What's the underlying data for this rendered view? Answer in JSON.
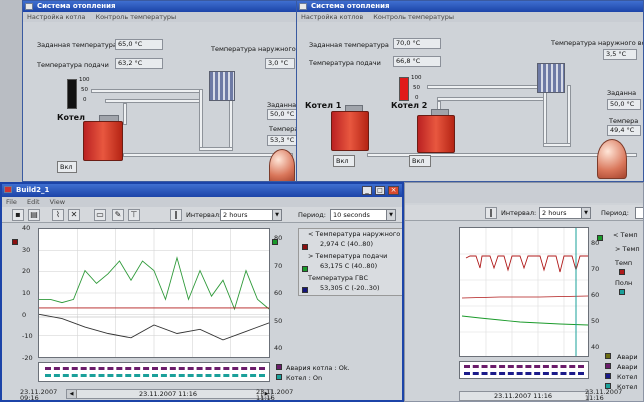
{
  "windows": {
    "heating_left": {
      "title": "Система отопления",
      "menu": [
        "Настройка котла",
        "Контроль температуры"
      ],
      "labels": {
        "set_temp": "Заданная температура",
        "supply_temp": "Температура подачи",
        "outdoor_temp": "Температура наружного воз",
        "boiler": "Котел",
        "right_set": "Заданна",
        "right_temp": "Темпера"
      },
      "values": {
        "set_temp": "65,0 °C",
        "supply_temp": "63,2 °C",
        "outdoor_temp": "3,0 °C",
        "right_set": "50,0 °C",
        "right_temp": "53,3 °C",
        "range_top": "100",
        "range_mid": "50",
        "range_bot": "0"
      },
      "on_button": "Вкл"
    },
    "heating_right": {
      "title": "Система отопления",
      "menu": [
        "Настройка котлов",
        "Контроль температуры"
      ],
      "labels": {
        "set_temp": "Заданная температура",
        "supply_temp": "Температура подачи",
        "outdoor_temp": "Температура наружного во",
        "boiler1": "Котел 1",
        "boiler2": "Котел 2",
        "right_set": "Заданна",
        "right_temp": "Темпера"
      },
      "values": {
        "set_temp": "70,0 °C",
        "supply_temp": "66,8 °C",
        "outdoor_temp": "3,5 °C",
        "right_set": "50,0 °C",
        "right_temp": "49,4 °C",
        "range_top": "100",
        "range_mid": "50",
        "range_bot": "0"
      },
      "on_button1": "Вкл",
      "on_button2": "Вкл"
    },
    "build": {
      "title": "Build2_1",
      "menu": [
        "File",
        "Edit",
        "View"
      ],
      "interval_label": "Интервал:",
      "interval_value": "2 hours",
      "period_label": "Период:",
      "period_value": "10 seconds",
      "legend": [
        {
          "name": "< Температура наружного в",
          "value": "2,974 C  (40..80)",
          "color": "#8b1010"
        },
        {
          "name": "> Температура подачи",
          "value": "63,175 C  (40..80)",
          "color": "#1a9a2a"
        },
        {
          "name": "Температура ГВС",
          "value": "53,305 C  (-20..30)",
          "color": "#14147a"
        }
      ],
      "alarms": [
        {
          "name": "Авария котла : Ok.",
          "color": "#6b1c6b"
        },
        {
          "name": "Котел : On",
          "color": "#1aa09a"
        }
      ],
      "y_left_ticks": [
        "40",
        "30",
        "20",
        "10",
        "0",
        "-10",
        "-20"
      ],
      "y_right_ticks": [
        "80",
        "70",
        "60",
        "50",
        "40"
      ],
      "x_start": "23.11.2007\n09:16",
      "x_center": "23.11.2007 11:16",
      "x_end": "23.11.2007\n11:16",
      "ctl_mid": "2 hours"
    },
    "trend_right": {
      "interval_label": "Интервал:",
      "interval_value": "2 hours",
      "period_label": "Период:",
      "legend": [
        "< Темп",
        "> Темп",
        "Темп",
        "Полн"
      ],
      "y_ticks": [
        "80",
        "70",
        "60",
        "50",
        "40"
      ],
      "alarms": [
        "Авари",
        "Авари",
        "Котел",
        "Котел"
      ],
      "x_center": "23.11.2007 11:16",
      "x_end": "23.11.2007\n11:16"
    }
  },
  "chart_data": [
    {
      "type": "line",
      "title": "Build2_1",
      "x_range": [
        "23.11.2007 09:16",
        "23.11.2007 11:16"
      ],
      "ylim_left": [
        -20,
        40
      ],
      "ylim_right": [
        40,
        80
      ],
      "series": [
        {
          "name": "Температура подачи",
          "x": [
            0,
            5,
            10,
            15,
            20,
            25,
            30,
            35,
            40,
            45,
            50,
            55,
            60,
            65,
            70,
            75,
            80,
            85,
            90,
            95,
            100
          ],
          "values": [
            58,
            58,
            57,
            58,
            67,
            63,
            66,
            70,
            64,
            70,
            67,
            58,
            71,
            58,
            67,
            59,
            64,
            55,
            67,
            58,
            55
          ]
        },
        {
          "name": "Температура наружного в",
          "x": [
            0,
            10,
            20,
            30,
            40,
            50,
            60,
            70,
            80,
            90,
            100
          ],
          "values": [
            0,
            -2,
            -6,
            -9,
            -11,
            -5,
            -9,
            -7,
            -12,
            -8,
            -4
          ]
        },
        {
          "name": "Температура ГВС",
          "x": [
            0,
            25,
            50,
            75,
            100
          ],
          "values": [
            3,
            3,
            3,
            3,
            3
          ]
        }
      ]
    }
  ]
}
